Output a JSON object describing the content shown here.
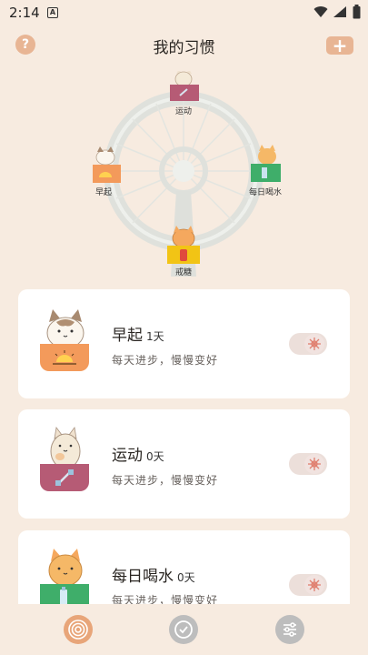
{
  "status": {
    "time": "2:14",
    "notif_icon": "A"
  },
  "header": {
    "title": "我的习惯",
    "help_label": "?",
    "add_label": "+"
  },
  "wheel": {
    "labels": {
      "top": "运动",
      "left": "早起",
      "right": "每日喝水",
      "bottom": "戒糖"
    }
  },
  "habits": [
    {
      "name": "早起",
      "days": "1天",
      "subtitle": "每天进步，慢慢变好",
      "color": "#f39a5b"
    },
    {
      "name": "运动",
      "days": "0天",
      "subtitle": "每天进步，慢慢变好",
      "color": "#b65b75"
    },
    {
      "name": "每日喝水",
      "days": "0天",
      "subtitle": "每天进步，慢慢变好",
      "color": "#3fae6a"
    }
  ],
  "nav": {
    "items": [
      "target-icon",
      "check-circle-icon",
      "sliders-icon"
    ],
    "active_color": "#e8a579",
    "inactive_color": "#bdbdbd"
  }
}
